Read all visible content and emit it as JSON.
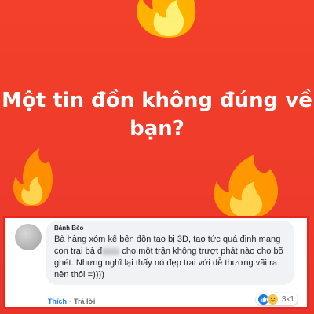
{
  "poster": {
    "headline_line1": "Một tin đồn không đúng về",
    "headline_line2": "bạn?"
  },
  "comment": {
    "author": "Bánh Bèo",
    "body_before_blur": "Bà hàng xóm kế bên đồn tao bị 3D, tao tức quá định mang con trai bà đ",
    "body_after_blur": " cho một trận không trượt phát nào cho bõ ghét. Nhưng nghĩ lại thấy nó đẹp trai với dễ thương vãi ra nên thôi =))))",
    "like_action": "Thích",
    "separator": "·",
    "reply_action": "Trả lời",
    "reaction_count": "3k1",
    "reaction_icons": [
      "like-icon",
      "haha-icon"
    ]
  },
  "colors": {
    "background": "#ee3b2b",
    "card_border": "#e8261d",
    "like_blue": "#1877f2"
  }
}
